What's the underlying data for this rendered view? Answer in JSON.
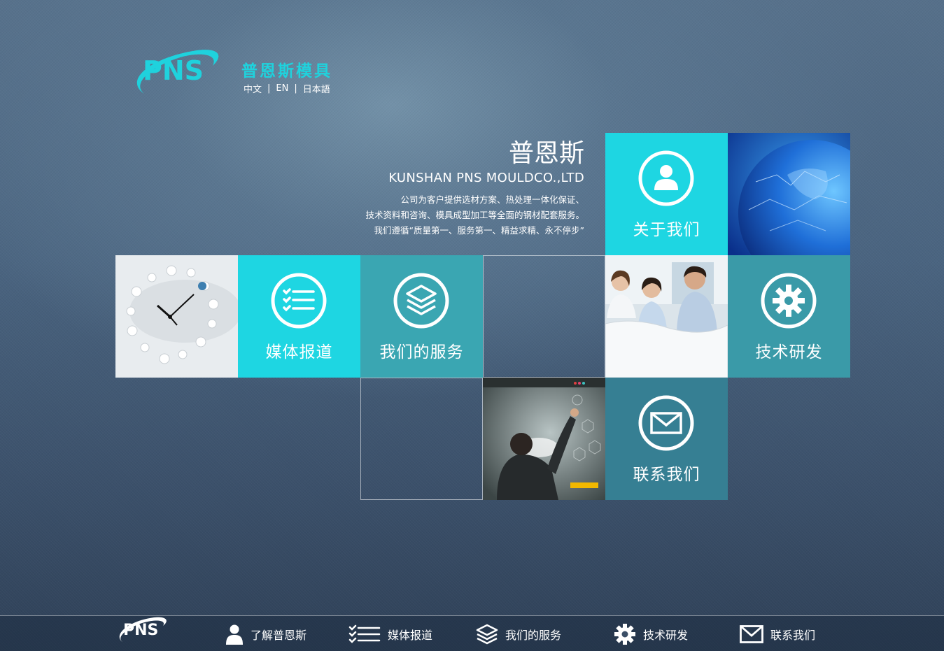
{
  "header": {
    "logo_text": "PNS",
    "brand_name": "普恩斯模具",
    "languages": [
      "中文",
      "EN",
      "日本語"
    ],
    "language_separator": "|"
  },
  "intro": {
    "title": "普恩斯",
    "subtitle": "KUNSHAN PNS MOULDCO.,LTD",
    "lines": [
      "公司为客户提供选材方案、热处理一体化保证、",
      "技术资料和咨询、模具成型加工等全面的钢材配套服务。",
      "我们遵循“质量第一、服务第一、精益求精、永不停步”"
    ]
  },
  "tiles": {
    "about": "关于我们",
    "media": "媒体报道",
    "services": "我们的服务",
    "tech": "技术研发",
    "contact": "联系我们"
  },
  "footer": {
    "logo_text": "PNS",
    "items": [
      "了解普恩斯",
      "媒体报道",
      "我们的服务",
      "技术研发",
      "联系我们"
    ]
  },
  "colors": {
    "accent_cyan": "#1ed6e2",
    "tile_teal": "#3aa6b2",
    "tile_dark_teal": "#367f93",
    "background": "#4a6480"
  },
  "icons": {
    "about": "user-icon",
    "media": "checklist-icon",
    "services": "layers-icon",
    "tech": "gear-icon",
    "contact": "mail-icon"
  }
}
